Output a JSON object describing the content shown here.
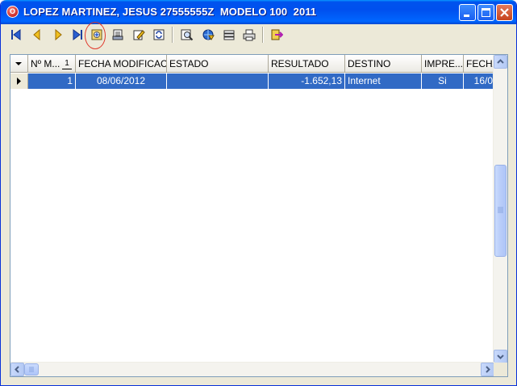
{
  "window": {
    "title": "LOPEZ MARTINEZ, JESUS 27555555Z  MODELO 100  2011",
    "app_icon_glyph": "O",
    "controls": [
      "minimize",
      "maximize",
      "close"
    ]
  },
  "toolbar": {
    "buttons": [
      {
        "name": "first-record-icon"
      },
      {
        "name": "previous-record-icon"
      },
      {
        "name": "next-record-icon"
      },
      {
        "name": "last-record-icon"
      },
      {
        "name": "new-record-icon"
      },
      {
        "name": "print-preview-icon"
      },
      {
        "name": "edit-record-icon"
      },
      {
        "name": "refresh-icon"
      },
      {
        "name": "search-icon"
      },
      {
        "name": "internet-send-icon"
      },
      {
        "name": "list-icon"
      },
      {
        "name": "print-icon"
      },
      {
        "name": "exit-icon"
      }
    ],
    "accent": "#f0c020"
  },
  "grid": {
    "columns": [
      {
        "label": "Nº M...",
        "sort_index": "1"
      },
      {
        "label": "FECHA MODIFICAC..."
      },
      {
        "label": "ESTADO"
      },
      {
        "label": "RESULTADO"
      },
      {
        "label": "DESTINO"
      },
      {
        "label": "IMPRE..."
      },
      {
        "label": "FECHA"
      }
    ],
    "rows": [
      {
        "num": "1",
        "fecha_mod": "08/06/2012",
        "estado": "",
        "resultado": "-1.652,13",
        "destino": "Internet",
        "impreso": "Si",
        "fecha": "16/0"
      }
    ],
    "selection_color": "#316ac5"
  }
}
